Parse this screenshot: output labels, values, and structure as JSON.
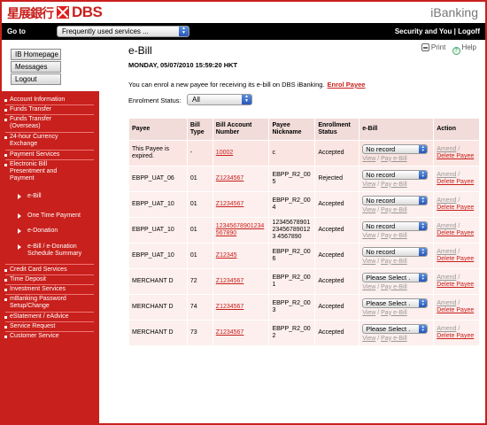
{
  "header": {
    "logo_chinese": "星展銀行",
    "logo_brand": "DBS",
    "product": "iBanking"
  },
  "topbar": {
    "goto_label": "Go to",
    "goto_select": "Frequently used services ...",
    "right_links": "Security and You | Logoff"
  },
  "side_buttons": [
    "IB Homepage",
    "Messages",
    "Logout"
  ],
  "nav": {
    "items": [
      "Account Information",
      "Funds Transfer",
      "Funds Transfer (Overseas)",
      "24-hour Currency Exchange",
      "Payment Services",
      "Electronic Bill Presentment and Payment",
      "Credit Card Services",
      "Time Deposit",
      "Investment Services",
      "mBanking Password Setup/Change",
      "eStatement / eAdvice",
      "Service Request",
      "Customer Service"
    ],
    "sub_items": [
      "e-Bill",
      "One Time Payment",
      "e-Donation",
      "e-Bill / e-Donation Schedule Summary"
    ]
  },
  "page": {
    "title": "e-Bill",
    "print_label": "Print",
    "help_label": "Help",
    "datetime": "MONDAY, 05/07/2010 15:59:20 HKT",
    "enrol_note": "You can enrol a new payee for receiving its e-bill on DBS iBanking.",
    "enrol_link": "Enrol Payee",
    "status_label": "Enrolment Status:",
    "status_value": "All"
  },
  "table": {
    "headers": [
      "Payee",
      "Bill Type",
      "Bill Account Number",
      "Payee Nickname",
      "Enrollment Status",
      "e-Bill",
      "Action"
    ],
    "view_label": "View",
    "pay_label": "Pay e-Bill",
    "amend_label": "Amend",
    "delete_label": "Delete Payee",
    "rows": [
      {
        "payee": "This Payee is expired.",
        "bill_type": "-",
        "account": "10002",
        "nickname": "c",
        "status": "Accepted",
        "ebill": "No record"
      },
      {
        "payee": "EBPP_UAT_06",
        "bill_type": "01",
        "account": "Z1234567",
        "nickname": "EBPP_R2_005",
        "status": "Rejected",
        "ebill": "No record"
      },
      {
        "payee": "EBPP_UAT_10",
        "bill_type": "01",
        "account": "Z1234567",
        "nickname": "EBPP_R2_004",
        "status": "Accepted",
        "ebill": "No record"
      },
      {
        "payee": "EBPP_UAT_10",
        "bill_type": "01",
        "account": "12345678901234567890",
        "nickname": "12345678901234567890123 4567890",
        "status": "Accepted",
        "ebill": "No record"
      },
      {
        "payee": "EBPP_UAT_10",
        "bill_type": "01",
        "account": "Z12345",
        "nickname": "EBPP_R2_006",
        "status": "Accepted",
        "ebill": "No record"
      },
      {
        "payee": "MERCHANT D",
        "bill_type": "72",
        "account": "Z1234567",
        "nickname": "EBPP_R2_001",
        "status": "Accepted",
        "ebill": "Please Select ."
      },
      {
        "payee": "MERCHANT D",
        "bill_type": "74",
        "account": "Z1234567",
        "nickname": "EBPP_R2_003",
        "status": "Accepted",
        "ebill": "Please Select ."
      },
      {
        "payee": "MERCHANT D",
        "bill_type": "73",
        "account": "Z1234567",
        "nickname": "EBPP_R2_002",
        "status": "Accepted",
        "ebill": "Please Select ."
      }
    ]
  },
  "colors": {
    "brand_red": "#c8201c",
    "header_row": "#f1dcd9",
    "body_row": "#fcefed"
  }
}
